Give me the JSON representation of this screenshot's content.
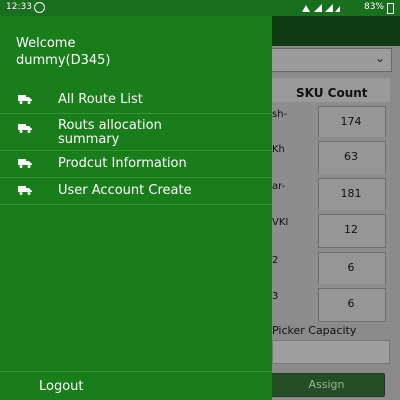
{
  "status_bar": {
    "time": "12:33",
    "battery": "83%"
  },
  "drawer": {
    "welcome_line1": "Welcome",
    "welcome_line2": "dummy(D345)",
    "items": [
      {
        "label": "All Route List",
        "icon": "truck-icon"
      },
      {
        "label_line1": "Routs allocation",
        "label_line2": "summary",
        "icon": "truck-icon"
      },
      {
        "label": "Prodcut Information",
        "icon": "truck-icon"
      },
      {
        "label": "User Account Create",
        "icon": "truck-icon"
      }
    ],
    "logout": "Logout"
  },
  "background": {
    "table_header": "SKU Count",
    "rows": [
      {
        "left": "sh-",
        "count": "174"
      },
      {
        "left": "Kh",
        "count": "63"
      },
      {
        "left": "ar-",
        "count": "181"
      },
      {
        "left": "VKI",
        "count": "12"
      },
      {
        "left": "2",
        "count": "6"
      },
      {
        "left": "3",
        "count": "6"
      }
    ],
    "picker_label": "Picker Capacity",
    "assign_label": "Assign"
  },
  "colors": {
    "drawer": "#187d1a",
    "status_bar": "#1a6f1e",
    "scrim_bg": "#8a8a8a"
  }
}
